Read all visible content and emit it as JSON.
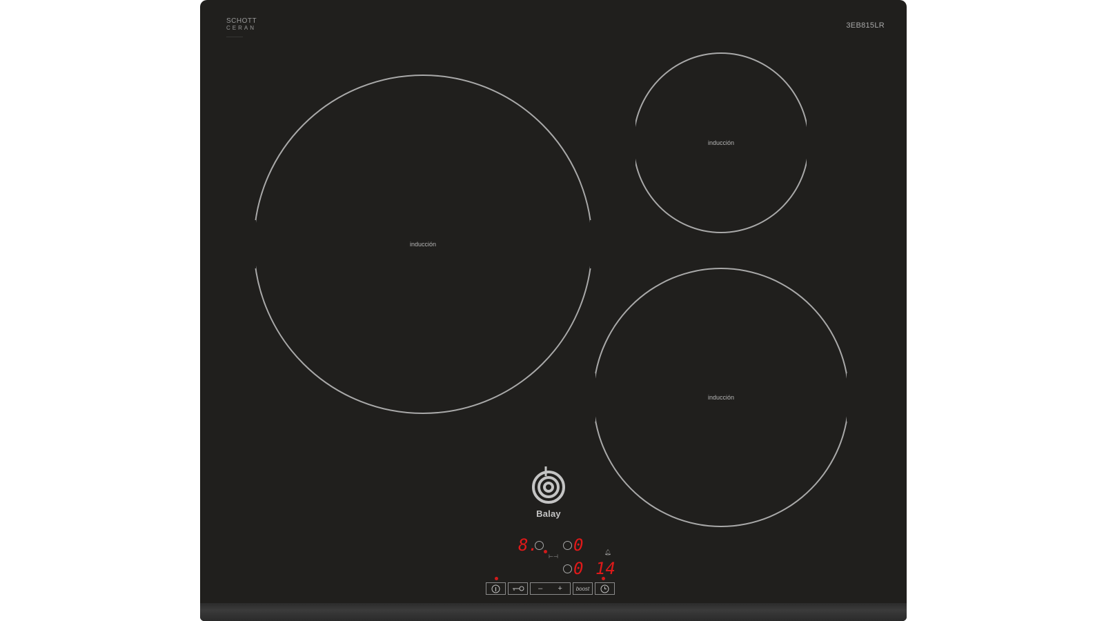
{
  "brand": {
    "glass_line1": "SCHOTT",
    "glass_line2": "CERAN",
    "maker": "Balay",
    "model": "3EB815LR"
  },
  "zones": [
    {
      "label": "inducción"
    },
    {
      "label": "inducción"
    },
    {
      "label": "inducción"
    }
  ],
  "display": {
    "zone_left_level": "8.",
    "zone_right_level": "0",
    "zone_bottom_level": "0",
    "timer_value": "14"
  },
  "controls": {
    "boost_label": "boost",
    "minus_label": "–",
    "plus_label": "+"
  },
  "icons": {
    "info": "info-icon",
    "lock": "key-lock-icon",
    "timer": "clock-icon",
    "bell": "bell-icon"
  },
  "colors": {
    "glass": "#201f1d",
    "indicator": "#e01919"
  }
}
